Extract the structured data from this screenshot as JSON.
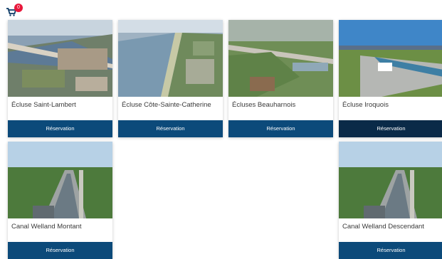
{
  "cart": {
    "count": "0",
    "icon": "shopping-cart-icon"
  },
  "colors": {
    "button": "#0c4a7a",
    "button_active": "#0a2a48",
    "badge": "#e8173a"
  },
  "cards": [
    {
      "title": "Écluse Saint-Lambert",
      "button": "Réservation"
    },
    {
      "title": "Écluse Côte-Sainte-Catherine",
      "button": "Réservation"
    },
    {
      "title": "Écluses Beauharnois",
      "button": "Réservation"
    },
    {
      "title": "Écluse Iroquois",
      "button": "Réservation"
    },
    {
      "title": "Canal Welland Montant",
      "button": "Réservation"
    },
    {
      "title": "Canal Welland Descendant",
      "button": "Réservation"
    }
  ]
}
